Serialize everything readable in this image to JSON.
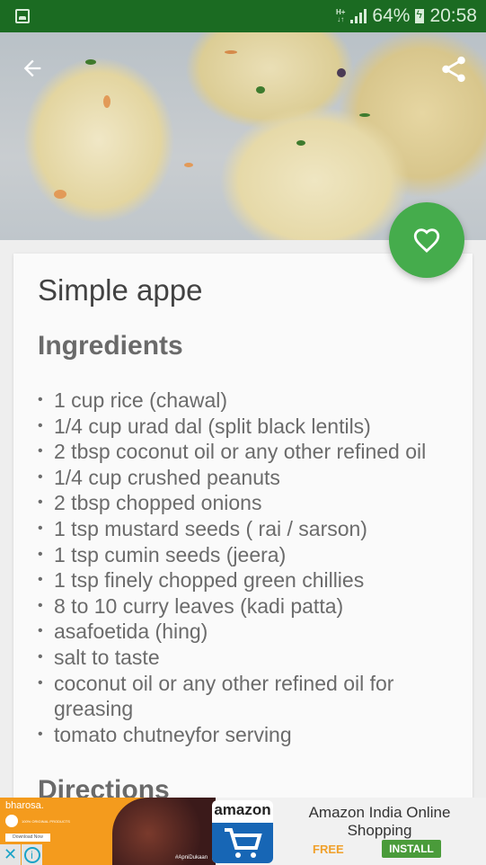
{
  "status_bar": {
    "network": "H+",
    "battery": "64%",
    "time": "20:58"
  },
  "header": {
    "back_icon": "arrow-back-icon",
    "share_icon": "share-icon",
    "favorite_icon": "heart-outline-icon"
  },
  "recipe": {
    "title": "Simple appe",
    "ingredients_heading": "Ingredients",
    "ingredients": [
      "1 cup rice (chawal)",
      "1/4 cup urad dal (split black lentils)",
      "2 tbsp coconut oil or any other refined oil",
      "1/4 cup crushed peanuts",
      "2 tbsp chopped onions",
      "1 tsp mustard seeds ( rai / sarson)",
      "1 tsp cumin seeds (jeera)",
      "1 tsp finely chopped green chillies",
      "8 to 10 curry leaves (kadi patta)",
      "asafoetida (hing)",
      " salt to taste",
      " coconut oil or any other refined oil for greasing",
      " tomato chutneyfor serving"
    ],
    "directions_heading": "Directions"
  },
  "ad": {
    "banner_text": "bharosa.",
    "badge_text": "100% ORIGINAL PRODUCTS",
    "download_label": "Download Now",
    "hashtag": "#ApniDukaan",
    "logo_word": "amazon",
    "app_title": "Amazon India Online Shopping",
    "price": "FREE",
    "install_label": "INSTALL",
    "close_icon": "close-icon",
    "info_icon": "info-icon"
  }
}
